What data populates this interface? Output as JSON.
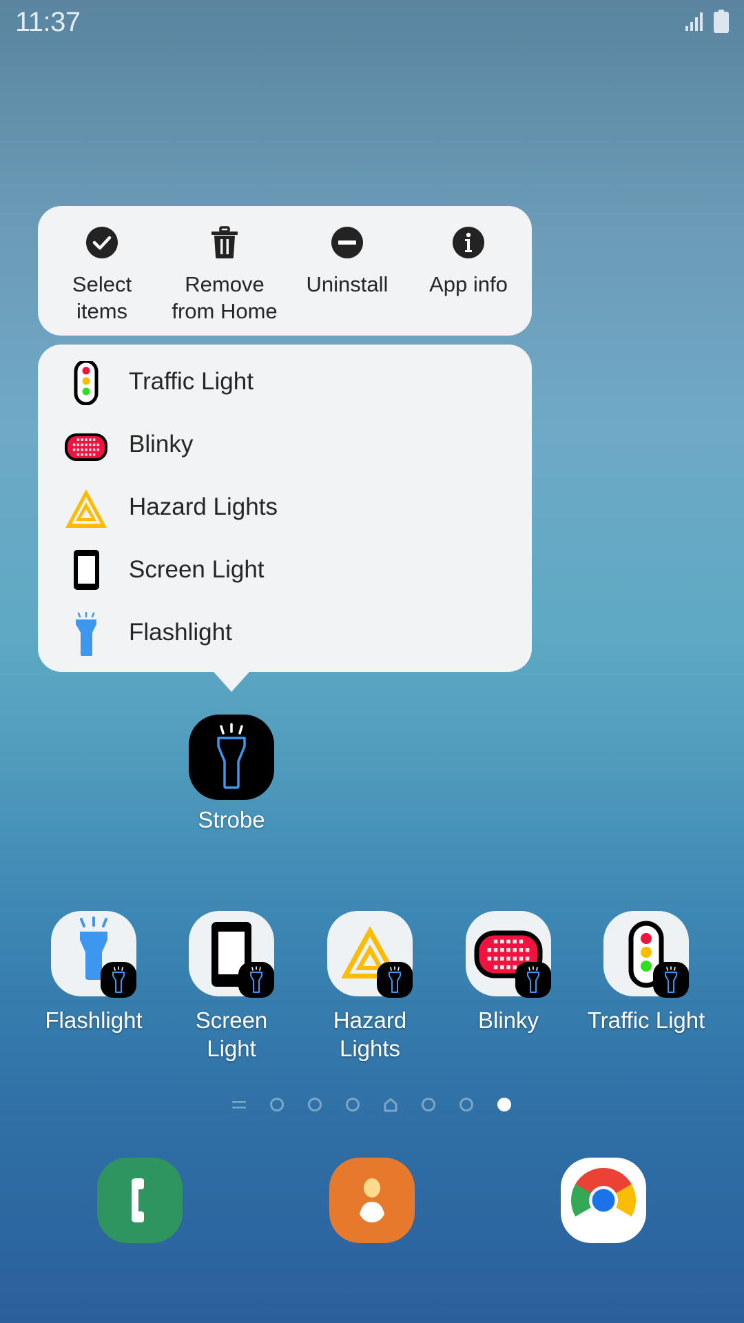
{
  "status_bar": {
    "time": "11:37",
    "signal_icon": "signal-bars-icon",
    "battery_icon": "battery-full-icon"
  },
  "context_menu": {
    "actions": [
      {
        "label_line1": "Select",
        "label_line2": "items",
        "icon": "check-circle-icon"
      },
      {
        "label_line1": "Remove",
        "label_line2": "from Home",
        "icon": "trash-icon"
      },
      {
        "label_line1": "Uninstall",
        "label_line2": "",
        "icon": "minus-circle-icon"
      },
      {
        "label_line1": "App info",
        "label_line2": "",
        "icon": "info-circle-icon"
      }
    ],
    "shortcuts": [
      {
        "label": "Traffic Light",
        "icon": "traffic-light-icon"
      },
      {
        "label": "Blinky",
        "icon": "blinky-icon"
      },
      {
        "label": "Hazard Lights",
        "icon": "hazard-triangle-icon"
      },
      {
        "label": "Screen Light",
        "icon": "phone-screen-icon"
      },
      {
        "label": "Flashlight",
        "icon": "flashlight-icon"
      }
    ]
  },
  "selected_app": {
    "label": "Strobe",
    "icon": "strobe-flashlight-icon"
  },
  "home_apps": [
    {
      "line1": "Flashlight",
      "line2": ""
    },
    {
      "line1": "Screen",
      "line2": "Light"
    },
    {
      "line1": "Hazard",
      "line2": "Lights"
    },
    {
      "line1": "Blinky",
      "line2": ""
    },
    {
      "line1": "Traffic Light",
      "line2": ""
    }
  ],
  "page_indicator": {
    "total_pages": 7,
    "current_page": 7,
    "home_page": 4,
    "has_list_view": true
  },
  "dock": [
    {
      "name": "Phone",
      "color": "#2f9560"
    },
    {
      "name": "Contacts",
      "color": "#e6792b"
    },
    {
      "name": "Chrome",
      "color": "#ffffff"
    }
  ],
  "colors": {
    "menu_bg": "#f1f3f5",
    "flashlight_blue": "#3d97ef",
    "hazard_yellow": "#ffbb00",
    "blinky_red": "#f0123f"
  }
}
